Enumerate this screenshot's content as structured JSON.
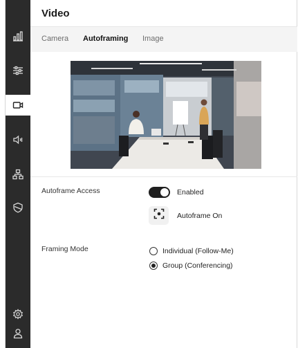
{
  "sidebar": {
    "items": [
      {
        "icon": "bar-chart-icon"
      },
      {
        "icon": "sliders-icon"
      },
      {
        "icon": "video-camera-icon",
        "active": true
      },
      {
        "icon": "speaker-icon"
      },
      {
        "icon": "network-icon"
      },
      {
        "icon": "shield-icon"
      }
    ],
    "bottom_items": [
      {
        "icon": "gear-icon"
      },
      {
        "icon": "user-icon"
      }
    ],
    "background": "#2b2b2b"
  },
  "page": {
    "title": "Video"
  },
  "tabs": [
    {
      "label": "Camera",
      "active": false
    },
    {
      "label": "Autoframing",
      "active": true
    },
    {
      "label": "Image",
      "active": false
    }
  ],
  "preview": {
    "icon": "camera-preview-image"
  },
  "autoframe_access": {
    "label": "Autoframe Access",
    "toggle_on": true,
    "toggle_text": "Enabled",
    "status_icon": "autoframe-focus-icon",
    "status_text": "Autoframe On"
  },
  "framing_mode": {
    "label": "Framing Mode",
    "options": [
      {
        "label": "Individual (Follow-Me)",
        "selected": false
      },
      {
        "label": "Group (Conferencing)",
        "selected": true
      }
    ]
  }
}
